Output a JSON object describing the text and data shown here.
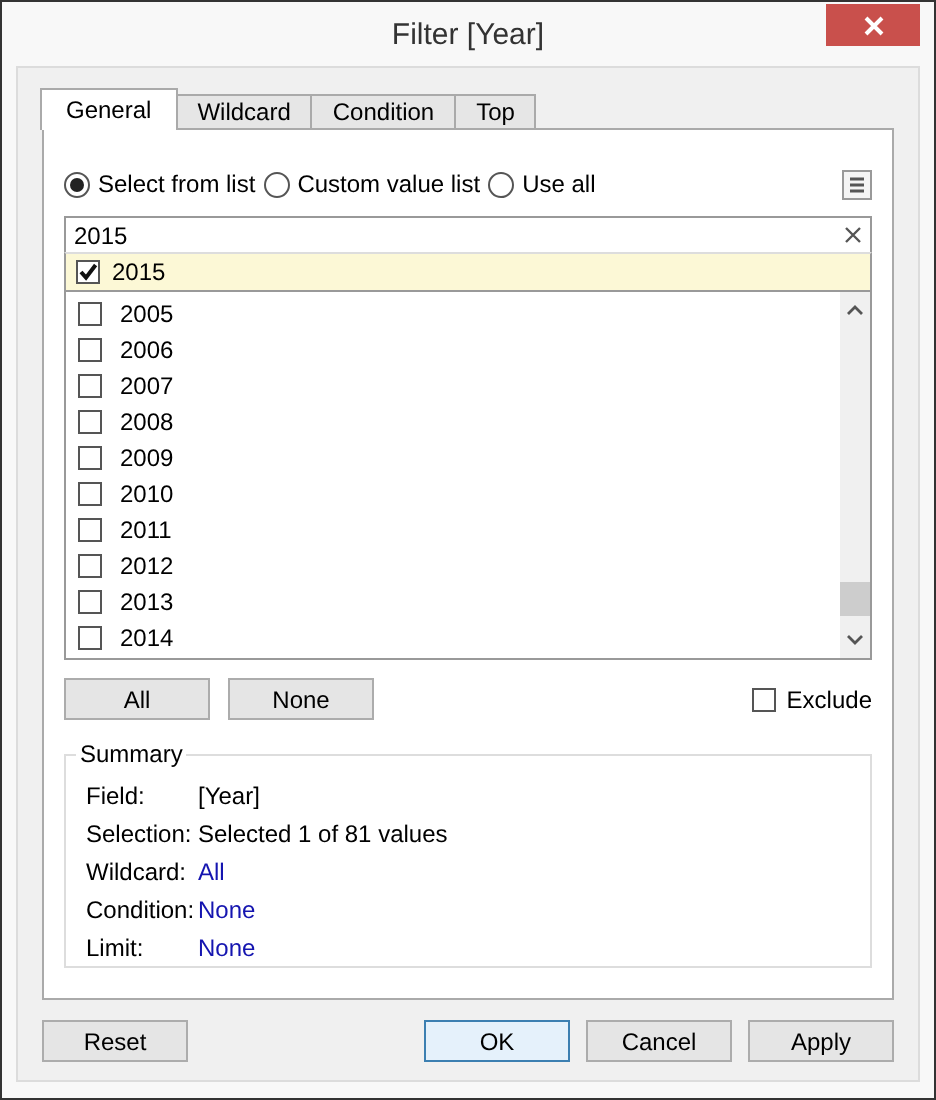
{
  "window": {
    "title": "Filter [Year]"
  },
  "tabs": [
    {
      "label": "General",
      "selected": true
    },
    {
      "label": "Wildcard",
      "selected": false
    },
    {
      "label": "Condition",
      "selected": false
    },
    {
      "label": "Top",
      "selected": false
    }
  ],
  "selection_modes": [
    {
      "label": "Select from list",
      "selected": true
    },
    {
      "label": "Custom value list",
      "selected": false
    },
    {
      "label": "Use all",
      "selected": false
    }
  ],
  "search": {
    "value": "2015"
  },
  "highlighted_item": {
    "label": "2015",
    "checked": true
  },
  "items": [
    {
      "label": "2005",
      "checked": false
    },
    {
      "label": "2006",
      "checked": false
    },
    {
      "label": "2007",
      "checked": false
    },
    {
      "label": "2008",
      "checked": false
    },
    {
      "label": "2009",
      "checked": false
    },
    {
      "label": "2010",
      "checked": false
    },
    {
      "label": "2011",
      "checked": false
    },
    {
      "label": "2012",
      "checked": false
    },
    {
      "label": "2013",
      "checked": false
    },
    {
      "label": "2014",
      "checked": false
    }
  ],
  "list_buttons": [
    "All",
    "None"
  ],
  "exclude": {
    "label": "Exclude",
    "checked": false
  },
  "summary": {
    "title": "Summary",
    "rows": [
      {
        "label": "Field:",
        "value": "[Year]",
        "link": false
      },
      {
        "label": "Selection:",
        "value": "Selected 1 of 81 values",
        "link": false
      },
      {
        "label": "Wildcard:",
        "value": "All",
        "link": true
      },
      {
        "label": "Condition:",
        "value": "None",
        "link": true
      },
      {
        "label": "Limit:",
        "value": "None",
        "link": true
      }
    ]
  },
  "buttons": [
    {
      "label": "Reset",
      "default": false
    },
    {
      "label": "OK",
      "default": true
    },
    {
      "label": "Cancel",
      "default": false
    },
    {
      "label": "Apply",
      "default": false
    }
  ]
}
